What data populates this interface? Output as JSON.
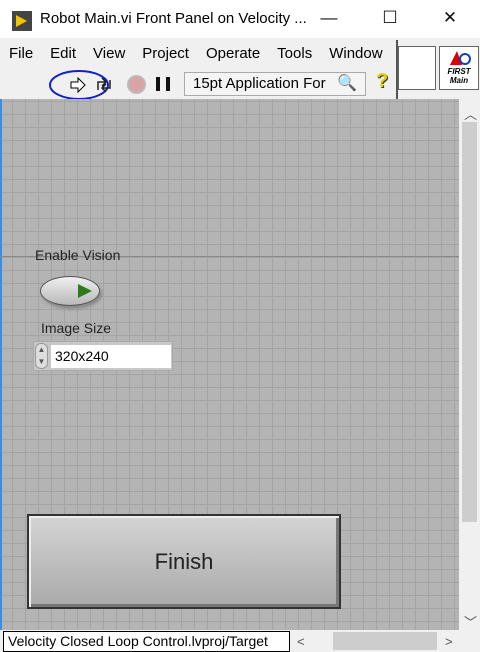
{
  "window": {
    "title": "Robot Main.vi Front Panel on Velocity ...",
    "minimize": "—",
    "maximize": "☐",
    "close": "✕"
  },
  "menu": [
    "File",
    "Edit",
    "View",
    "Project",
    "Operate",
    "Tools",
    "Window"
  ],
  "toolbar": {
    "font": "15pt Application For",
    "help": "?"
  },
  "icon_pane": {
    "vi_icon_text": "FIRST Main"
  },
  "controls": {
    "enable_vision_label": "Enable Vision",
    "image_size_label": "Image Size",
    "image_size_value": "320x240",
    "finish_label": "Finish"
  },
  "status": {
    "path": "Velocity Closed Loop Control.lvproj/Target"
  }
}
